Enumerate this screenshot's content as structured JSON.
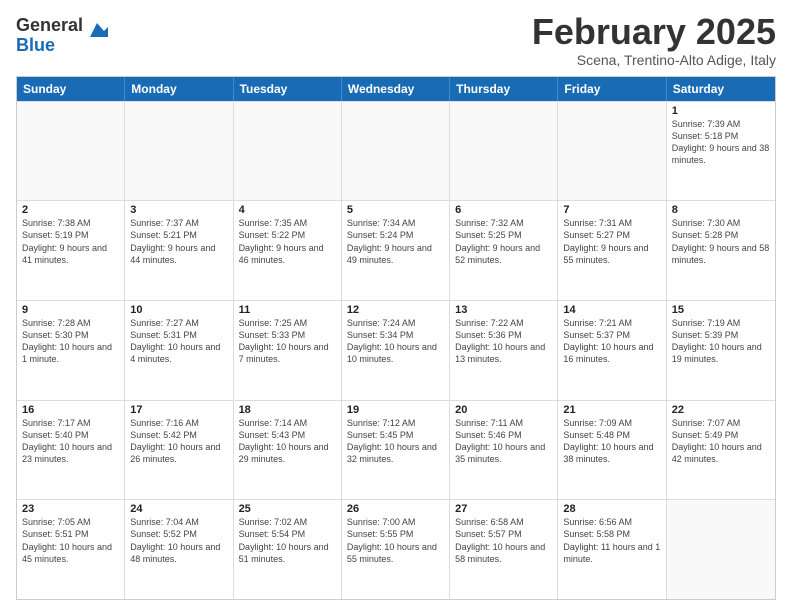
{
  "logo": {
    "general": "General",
    "blue": "Blue"
  },
  "header": {
    "month": "February 2025",
    "location": "Scena, Trentino-Alto Adige, Italy"
  },
  "weekdays": [
    "Sunday",
    "Monday",
    "Tuesday",
    "Wednesday",
    "Thursday",
    "Friday",
    "Saturday"
  ],
  "rows": [
    [
      {
        "day": "",
        "info": ""
      },
      {
        "day": "",
        "info": ""
      },
      {
        "day": "",
        "info": ""
      },
      {
        "day": "",
        "info": ""
      },
      {
        "day": "",
        "info": ""
      },
      {
        "day": "",
        "info": ""
      },
      {
        "day": "1",
        "info": "Sunrise: 7:39 AM\nSunset: 5:18 PM\nDaylight: 9 hours and 38 minutes."
      }
    ],
    [
      {
        "day": "2",
        "info": "Sunrise: 7:38 AM\nSunset: 5:19 PM\nDaylight: 9 hours and 41 minutes."
      },
      {
        "day": "3",
        "info": "Sunrise: 7:37 AM\nSunset: 5:21 PM\nDaylight: 9 hours and 44 minutes."
      },
      {
        "day": "4",
        "info": "Sunrise: 7:35 AM\nSunset: 5:22 PM\nDaylight: 9 hours and 46 minutes."
      },
      {
        "day": "5",
        "info": "Sunrise: 7:34 AM\nSunset: 5:24 PM\nDaylight: 9 hours and 49 minutes."
      },
      {
        "day": "6",
        "info": "Sunrise: 7:32 AM\nSunset: 5:25 PM\nDaylight: 9 hours and 52 minutes."
      },
      {
        "day": "7",
        "info": "Sunrise: 7:31 AM\nSunset: 5:27 PM\nDaylight: 9 hours and 55 minutes."
      },
      {
        "day": "8",
        "info": "Sunrise: 7:30 AM\nSunset: 5:28 PM\nDaylight: 9 hours and 58 minutes."
      }
    ],
    [
      {
        "day": "9",
        "info": "Sunrise: 7:28 AM\nSunset: 5:30 PM\nDaylight: 10 hours and 1 minute."
      },
      {
        "day": "10",
        "info": "Sunrise: 7:27 AM\nSunset: 5:31 PM\nDaylight: 10 hours and 4 minutes."
      },
      {
        "day": "11",
        "info": "Sunrise: 7:25 AM\nSunset: 5:33 PM\nDaylight: 10 hours and 7 minutes."
      },
      {
        "day": "12",
        "info": "Sunrise: 7:24 AM\nSunset: 5:34 PM\nDaylight: 10 hours and 10 minutes."
      },
      {
        "day": "13",
        "info": "Sunrise: 7:22 AM\nSunset: 5:36 PM\nDaylight: 10 hours and 13 minutes."
      },
      {
        "day": "14",
        "info": "Sunrise: 7:21 AM\nSunset: 5:37 PM\nDaylight: 10 hours and 16 minutes."
      },
      {
        "day": "15",
        "info": "Sunrise: 7:19 AM\nSunset: 5:39 PM\nDaylight: 10 hours and 19 minutes."
      }
    ],
    [
      {
        "day": "16",
        "info": "Sunrise: 7:17 AM\nSunset: 5:40 PM\nDaylight: 10 hours and 23 minutes."
      },
      {
        "day": "17",
        "info": "Sunrise: 7:16 AM\nSunset: 5:42 PM\nDaylight: 10 hours and 26 minutes."
      },
      {
        "day": "18",
        "info": "Sunrise: 7:14 AM\nSunset: 5:43 PM\nDaylight: 10 hours and 29 minutes."
      },
      {
        "day": "19",
        "info": "Sunrise: 7:12 AM\nSunset: 5:45 PM\nDaylight: 10 hours and 32 minutes."
      },
      {
        "day": "20",
        "info": "Sunrise: 7:11 AM\nSunset: 5:46 PM\nDaylight: 10 hours and 35 minutes."
      },
      {
        "day": "21",
        "info": "Sunrise: 7:09 AM\nSunset: 5:48 PM\nDaylight: 10 hours and 38 minutes."
      },
      {
        "day": "22",
        "info": "Sunrise: 7:07 AM\nSunset: 5:49 PM\nDaylight: 10 hours and 42 minutes."
      }
    ],
    [
      {
        "day": "23",
        "info": "Sunrise: 7:05 AM\nSunset: 5:51 PM\nDaylight: 10 hours and 45 minutes."
      },
      {
        "day": "24",
        "info": "Sunrise: 7:04 AM\nSunset: 5:52 PM\nDaylight: 10 hours and 48 minutes."
      },
      {
        "day": "25",
        "info": "Sunrise: 7:02 AM\nSunset: 5:54 PM\nDaylight: 10 hours and 51 minutes."
      },
      {
        "day": "26",
        "info": "Sunrise: 7:00 AM\nSunset: 5:55 PM\nDaylight: 10 hours and 55 minutes."
      },
      {
        "day": "27",
        "info": "Sunrise: 6:58 AM\nSunset: 5:57 PM\nDaylight: 10 hours and 58 minutes."
      },
      {
        "day": "28",
        "info": "Sunrise: 6:56 AM\nSunset: 5:58 PM\nDaylight: 11 hours and 1 minute."
      },
      {
        "day": "",
        "info": ""
      }
    ]
  ]
}
